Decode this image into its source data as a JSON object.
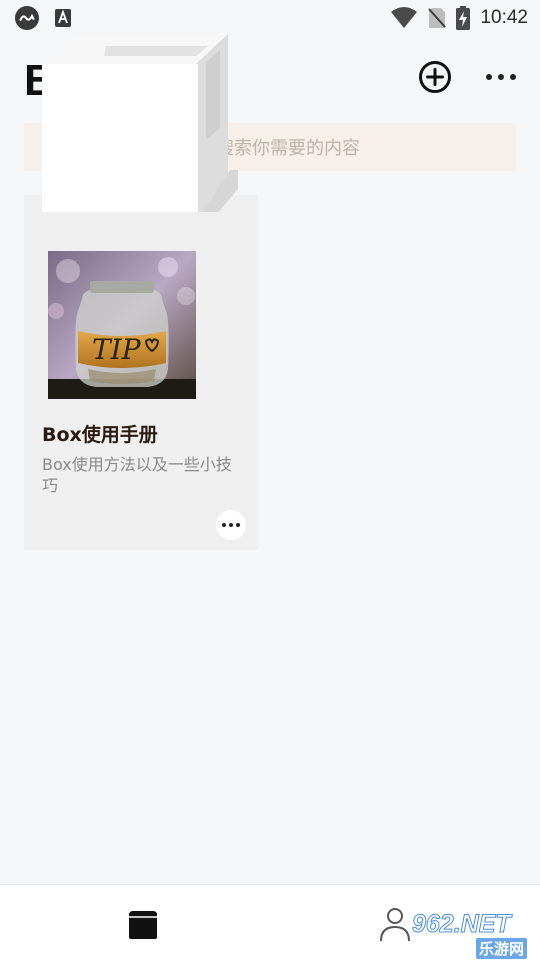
{
  "status_bar": {
    "time": "10:42",
    "left_icons": [
      "loop-icon",
      "font-a-icon"
    ],
    "right_icons": [
      "wifi-icon",
      "no-sim-icon",
      "battery-charging-icon"
    ]
  },
  "header": {
    "title": "Box",
    "add_icon": "add-circle-icon",
    "more_icon": "more-horizontal-icon"
  },
  "search": {
    "placeholder": "搜索你需要的内容",
    "icon": "search-icon"
  },
  "boxes": [
    {
      "title": "Box使用手册",
      "description": "Box使用方法以及一些小技巧",
      "cover_text": "TIP",
      "more_icon": "more-horizontal-icon"
    }
  ],
  "bottom_nav": {
    "items": [
      {
        "icon": "box-icon",
        "active": true
      },
      {
        "icon": "profile-icon",
        "active": false
      }
    ]
  },
  "watermark": {
    "main": "962.NET",
    "sub": "乐游网"
  },
  "colors": {
    "background": "#f5f6f8",
    "search_bg": "#f6efea",
    "card_bg": "#efefef",
    "title": "#111111",
    "desc": "#8a8a8a"
  }
}
